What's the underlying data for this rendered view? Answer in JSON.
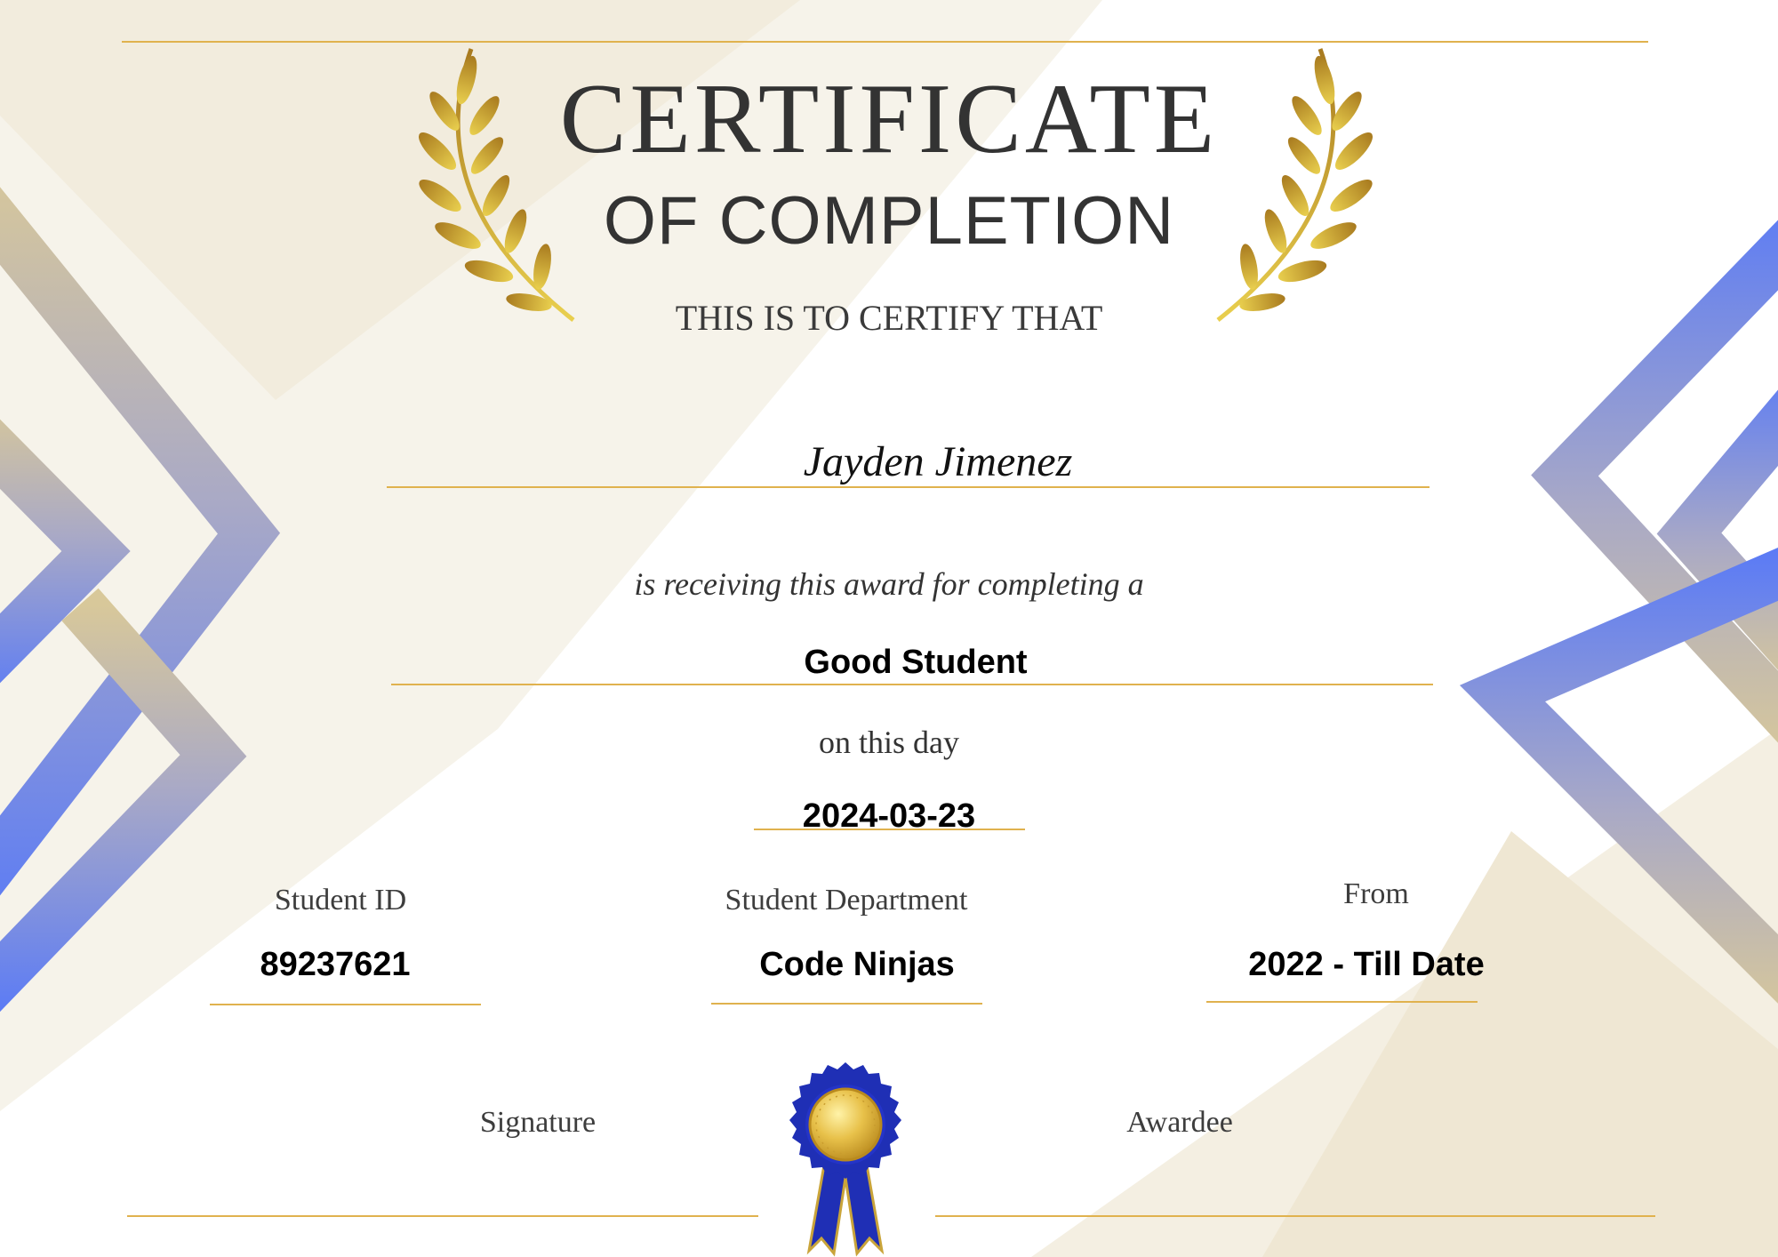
{
  "certificate": {
    "title": "CERTIFICATE",
    "subtitle": "OF COMPLETION",
    "certify_line": "THIS IS TO CERTIFY THAT",
    "recipient_name": "Jayden Jimenez",
    "award_line": "is  receiving this award for completing a",
    "award_title": "Good Student",
    "day_line": "on this day",
    "date": "2024-03-23"
  },
  "details": {
    "student_id_label": "Student ID",
    "student_id_value": "89237621",
    "department_label": "Student Department",
    "department_value": "Code Ninjas",
    "from_label": "From",
    "from_value": "2022 - Till Date"
  },
  "footer": {
    "signature_label": "Signature",
    "awardee_label": "Awardee"
  },
  "colors": {
    "gold_accent": "#e0b24e",
    "blue_accent": "#5b7bf5",
    "ribbon_blue": "#1f2fb5",
    "seal_gold": "#e8c14a"
  }
}
